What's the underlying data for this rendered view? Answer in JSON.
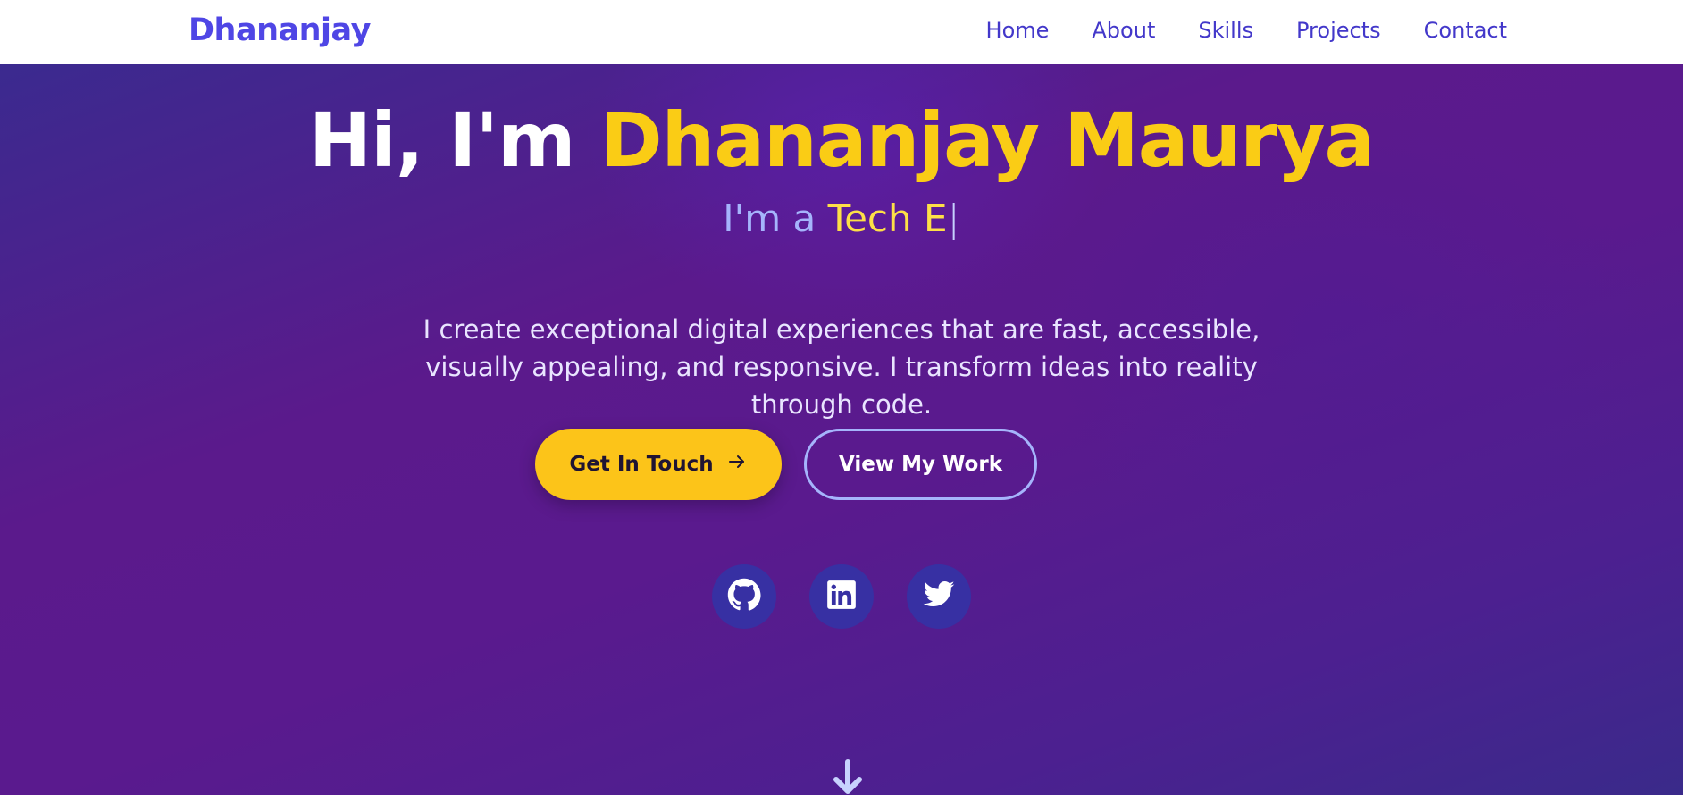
{
  "navbar": {
    "brand": "Dhananjay",
    "links": [
      "Home",
      "About",
      "Skills",
      "Projects",
      "Contact"
    ]
  },
  "hero": {
    "greeting": "Hi, I'm ",
    "name": "Dhananjay Maurya",
    "tagline_prefix": "I'm a ",
    "tagline_role": "Tech E",
    "tagline_cursor": "|",
    "intro": "I create exceptional digital experiences that are fast, accessible, visually appealing, and responsive. I transform ideas into reality through code.",
    "primary_button": "Get In Touch",
    "primary_button_icon": "arrow-right-icon",
    "secondary_button": "View My Work",
    "socials": [
      "github-icon",
      "linkedin-icon",
      "twitter-icon"
    ],
    "scroll_icon": "arrow-down-icon"
  },
  "colors": {
    "brand": "#4f46e5",
    "accent": "#facc15",
    "button_primary": "#fcc419",
    "social_bg": "#3730a3"
  }
}
